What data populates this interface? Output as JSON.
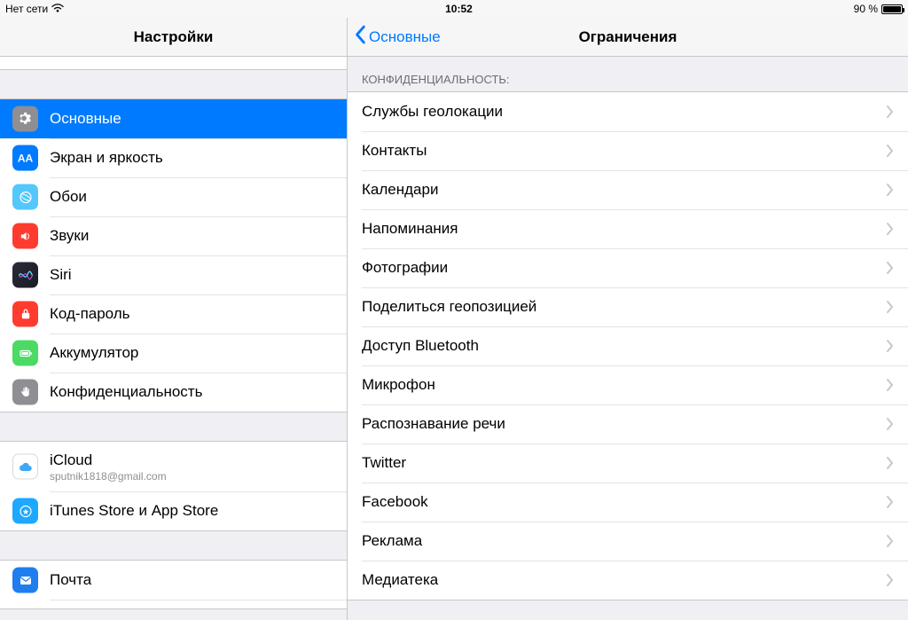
{
  "status": {
    "carrier": "Нет сети",
    "time": "10:52",
    "battery_text": "90 %"
  },
  "sidebar": {
    "title": "Настройки",
    "items": [
      {
        "id": "general",
        "label": "Основные",
        "selected": true
      },
      {
        "id": "display",
        "label": "Экран и яркость"
      },
      {
        "id": "wallpaper",
        "label": "Обои"
      },
      {
        "id": "sounds",
        "label": "Звуки"
      },
      {
        "id": "siri",
        "label": "Siri"
      },
      {
        "id": "passcode",
        "label": "Код-пароль"
      },
      {
        "id": "battery",
        "label": "Аккумулятор"
      },
      {
        "id": "privacy",
        "label": "Конфиденциальность"
      }
    ],
    "account": [
      {
        "id": "icloud",
        "label": "iCloud",
        "sublabel": "sputnik1818@gmail.com"
      },
      {
        "id": "store",
        "label": "iTunes Store и App Store"
      }
    ],
    "apps": [
      {
        "id": "mail",
        "label": "Почта"
      }
    ]
  },
  "detail": {
    "back_label": "Основные",
    "title": "Ограничения",
    "section_header": "КОНФИДЕНЦИАЛЬНОСТЬ:",
    "rows": [
      {
        "label": "Службы геолокации"
      },
      {
        "label": "Контакты"
      },
      {
        "label": "Календари"
      },
      {
        "label": "Напоминания"
      },
      {
        "label": "Фотографии"
      },
      {
        "label": "Поделиться геопозицией"
      },
      {
        "label": "Доступ Bluetooth"
      },
      {
        "label": "Микрофон"
      },
      {
        "label": "Распознавание речи"
      },
      {
        "label": "Twitter"
      },
      {
        "label": "Facebook"
      },
      {
        "label": "Реклама"
      },
      {
        "label": "Медиатека"
      }
    ]
  }
}
